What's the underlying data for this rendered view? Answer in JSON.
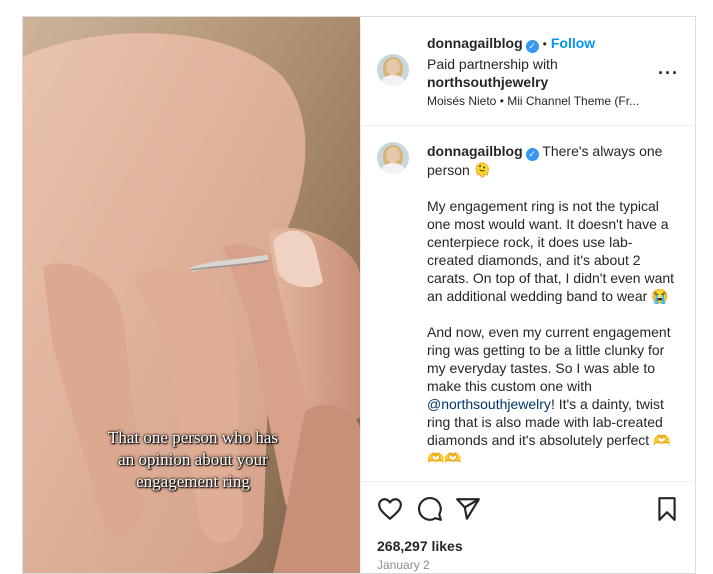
{
  "media": {
    "overlay_caption": "That one person who has\nan opinion about your\nengagement ring"
  },
  "header": {
    "username": "donnagailblog",
    "follow_label": "Follow",
    "partnership_text": "Paid partnership with",
    "partner_name": "northsouthjewelry",
    "audio_text": "Moisés Nieto • Mii Channel Theme (Fr..."
  },
  "caption": {
    "username": "donnagailblog",
    "lead": "There's always one person 🫠",
    "paragraph_1": "My engagement ring is not the typical one most would want. It doesn't have a centerpiece rock, it does use lab-created diamonds, and it's about 2 carats. On top of that, I didn't even want an additional wedding band to wear 😭",
    "paragraph_2_start": "And now, even my current engagement ring was getting to be a little clunky for my everyday tastes. So I was able to make this custom one with ",
    "mention": "@northsouthjewelry",
    "paragraph_2_end": "! It's a dainty, twist ring that is also made with lab-created diamonds and it's absolutely perfect 🫶🫶🫶"
  },
  "actions": {
    "icons": [
      "heart-icon",
      "comment-icon",
      "share-icon",
      "bookmark-icon"
    ]
  },
  "likes": "268,297 likes",
  "date": "January 2",
  "colors": {
    "link": "#0095f6",
    "verified": "#3897f0",
    "mention": "#00376b"
  }
}
